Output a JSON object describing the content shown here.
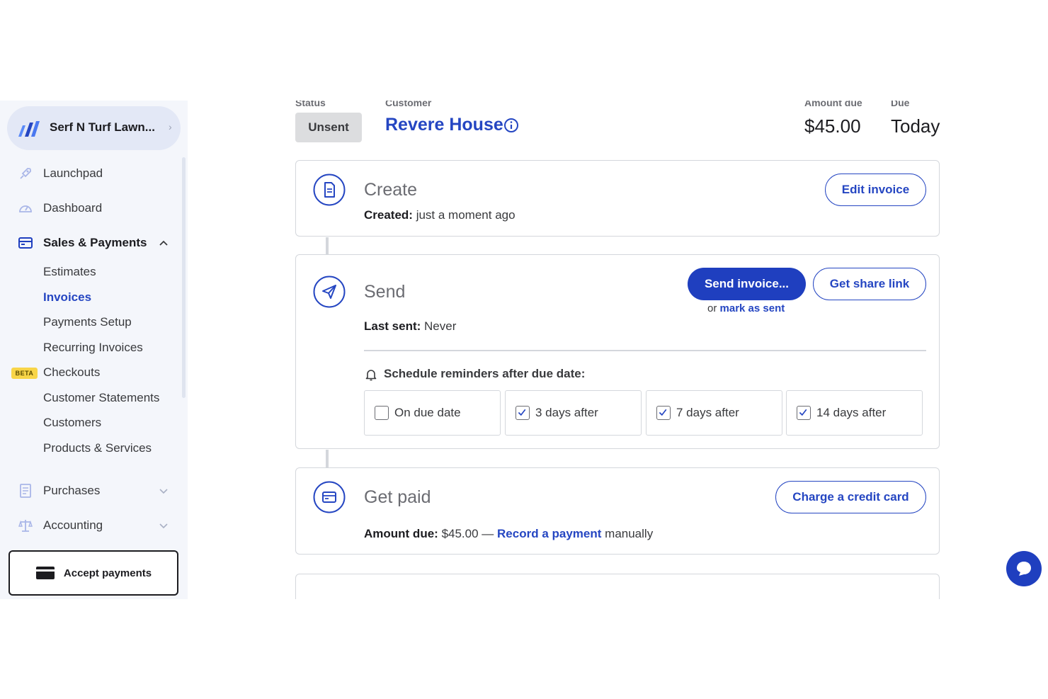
{
  "sidebar": {
    "business_name": "Serf N Turf Lawn...",
    "nav": {
      "launchpad": "Launchpad",
      "dashboard": "Dashboard",
      "sales_payments": "Sales & Payments",
      "purchases": "Purchases",
      "accounting": "Accounting"
    },
    "sales_sub": {
      "estimates": "Estimates",
      "invoices": "Invoices",
      "payments_setup": "Payments Setup",
      "recurring_invoices": "Recurring Invoices",
      "checkouts": "Checkouts",
      "checkouts_badge": "BETA",
      "customer_statements": "Customer Statements",
      "customers": "Customers",
      "products_services": "Products & Services"
    },
    "accept_payments": "Accept payments"
  },
  "header": {
    "status_label": "Status",
    "status_value": "Unsent",
    "customer_label": "Customer",
    "customer_name": "Revere House",
    "amount_label": "Amount due",
    "amount_value": "$45.00",
    "due_label": "Due",
    "due_value": "Today"
  },
  "create": {
    "title": "Create",
    "created_label": "Created:",
    "created_value": "just a moment ago",
    "edit_button": "Edit invoice"
  },
  "send": {
    "title": "Send",
    "send_button": "Send invoice...",
    "share_button": "Get share link",
    "or_text": "or",
    "mark_sent_link": "mark as sent",
    "last_sent_label": "Last sent:",
    "last_sent_value": "Never",
    "reminders_heading": "Schedule reminders after due date:",
    "reminders": [
      {
        "label": "On due date",
        "checked": false
      },
      {
        "label": "3 days after",
        "checked": true
      },
      {
        "label": "7 days after",
        "checked": true
      },
      {
        "label": "14 days after",
        "checked": true
      }
    ]
  },
  "get_paid": {
    "title": "Get paid",
    "charge_button": "Charge a credit card",
    "amount_due_label": "Amount due:",
    "amount_due_value": "$45.00 —",
    "record_link": "Record a payment",
    "manually_text": "manually"
  },
  "colors": {
    "accent": "#2546c2",
    "primary_button": "#1f3fbf",
    "sidebar_bg": "#f4f6fb",
    "border": "#d4d7dc"
  }
}
